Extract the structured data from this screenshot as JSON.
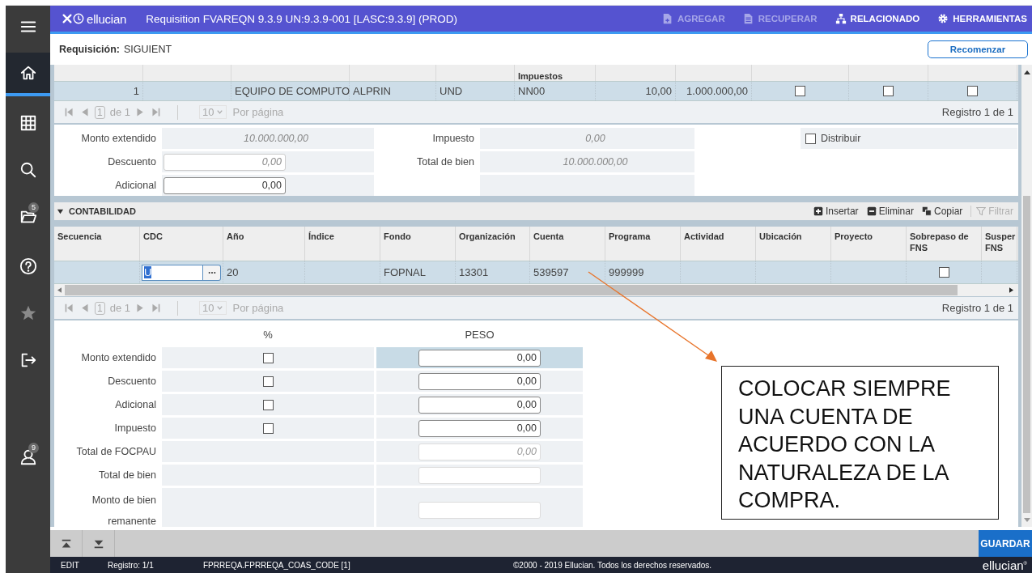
{
  "sidebar": {
    "items": [
      {
        "kind": "menu",
        "selected": false,
        "disabled": false
      },
      {
        "kind": "home",
        "selected": true,
        "disabled": false
      },
      {
        "kind": "grid",
        "selected": false,
        "disabled": false
      },
      {
        "kind": "search",
        "selected": false,
        "disabled": false
      },
      {
        "kind": "folder",
        "selected": false,
        "disabled": false,
        "badge": "5"
      },
      {
        "kind": "help",
        "selected": false,
        "disabled": false
      },
      {
        "kind": "star",
        "selected": false,
        "disabled": true
      },
      {
        "kind": "signout",
        "selected": false,
        "disabled": false
      },
      {
        "kind": "user",
        "selected": false,
        "disabled": false,
        "badge": "9"
      }
    ]
  },
  "header": {
    "logo": "ellucian",
    "title": "Requisition FVAREQN 9.3.9 UN:9.3.9-001 [LASC:9.3.9] (PROD)",
    "actions": [
      {
        "kind": "add",
        "label": "AGREGAR",
        "disabled": true
      },
      {
        "kind": "retrieve",
        "label": "RECUPERAR",
        "disabled": true
      },
      {
        "kind": "related",
        "label": "RELACIONADO",
        "disabled": false
      },
      {
        "kind": "tools",
        "label": "HERRAMIENTAS",
        "disabled": false
      }
    ]
  },
  "key_block": {
    "label": "Requisición:",
    "value": "SIGUIENT",
    "button": "Recomenzar"
  },
  "items_table": {
    "columns": [
      {
        "kind": "number"
      },
      {
        "kind": "text"
      },
      {
        "kind": "text"
      },
      {
        "kind": "text"
      },
      {
        "kind": "text"
      },
      {
        "kind": "text",
        "label": "Impuestos"
      },
      {
        "kind": "number"
      },
      {
        "kind": "number"
      },
      {
        "kind": "check"
      },
      {
        "kind": "check"
      },
      {
        "kind": "check"
      }
    ],
    "rows": [
      {
        "selected": true,
        "cells": [
          {
            "text": "1"
          },
          {},
          {
            "text": "EQUIPO DE COMPUTO"
          },
          {
            "text": "ALPRIN"
          },
          {
            "text": "UND"
          },
          {
            "text": "NN00"
          },
          {
            "text": "10,00"
          },
          {
            "text": "1.000.000,00"
          },
          {
            "checked": false
          },
          {
            "checked": false
          },
          {
            "checked": false
          }
        ]
      }
    ],
    "pager": {
      "page": "1",
      "of": "de 1",
      "per_page": "10",
      "per_page_label": "Por página",
      "record": "Registro 1 de 1"
    }
  },
  "amounts": {
    "left": [
      {
        "kind": "readonly",
        "label": "Monto extendido",
        "value": "10.000.000,00"
      },
      {
        "kind": "input",
        "label": "Descuento",
        "value": "0,00",
        "disabled": true
      },
      {
        "kind": "input",
        "label": "Adicional",
        "value": "0,00",
        "disabled": false
      }
    ],
    "middle": [
      {
        "kind": "readonly",
        "label": "Impuesto",
        "value": "0,00"
      },
      {
        "kind": "readonly",
        "label": "Total de bien",
        "value": "10.000.000,00"
      },
      {
        "kind": "empty"
      }
    ],
    "right": [
      {
        "kind": "checkbox",
        "label": "Distribuir",
        "checked": false
      }
    ]
  },
  "accounting": {
    "title": "CONTABILIDAD",
    "expanded": true,
    "tools": [
      {
        "kind": "insert",
        "label": "Insertar",
        "disabled": false
      },
      {
        "kind": "delete",
        "label": "Eliminar",
        "disabled": false
      },
      {
        "kind": "copy",
        "label": "Copiar",
        "disabled": false
      },
      {
        "kind": "filter",
        "label": "Filtrar",
        "disabled": true
      }
    ],
    "columns": [
      {
        "label": "Secuencia"
      },
      {
        "label": "CDC"
      },
      {
        "label": "Año"
      },
      {
        "label": "Índice"
      },
      {
        "label": "Fondo"
      },
      {
        "label": "Organización"
      },
      {
        "label": "Cuenta"
      },
      {
        "label": "Programa"
      },
      {
        "label": "Actividad"
      },
      {
        "label": "Ubicación"
      },
      {
        "label": "Proyecto"
      },
      {
        "label": "Sobrepaso de FNS"
      },
      {
        "label": "Susper FNS"
      }
    ],
    "rows": [
      {
        "selected": true,
        "cells": [
          {},
          {
            "kind": "lookup",
            "value": "U"
          },
          {
            "text": "20"
          },
          {},
          {
            "text": "FOPNAL"
          },
          {
            "text": "13301"
          },
          {
            "text": "539597"
          },
          {
            "text": "999999"
          },
          {},
          {},
          {},
          {
            "checked": false
          },
          {}
        ]
      }
    ],
    "pager": {
      "page": "1",
      "of": "de 1",
      "per_page": "10",
      "per_page_label": "Por página",
      "record": "Registro 1 de 1"
    }
  },
  "distribution": {
    "percent_header": "%",
    "amount_header": "PESO",
    "rows": [
      {
        "label": "Monto extendido",
        "checked": false,
        "kind": "input",
        "value": "0,00",
        "selected": true
      },
      {
        "label": "Descuento",
        "checked": false,
        "kind": "input",
        "value": "0,00",
        "selected": false
      },
      {
        "label": "Adicional",
        "checked": false,
        "kind": "input",
        "value": "0,00",
        "selected": false
      },
      {
        "label": "Impuesto",
        "checked": false,
        "kind": "input",
        "value": "0,00",
        "selected": false
      },
      {
        "label": "Total de FOCPAU",
        "kind": "readonly",
        "value": "0,00",
        "selected": false
      },
      {
        "label": "Total de bien",
        "kind": "readonly",
        "selected": false
      },
      {
        "label": "Monto de bien remanente",
        "kind": "readonly",
        "selected": false
      }
    ]
  },
  "annotation": {
    "text": "COLOCAR SIEMPRE UNA CUENTA DE ACUERDO CON LA NATURALEZA DE LA COMPRA."
  },
  "toolbar": {
    "nav": [
      {
        "kind": "first"
      },
      {
        "kind": "last"
      }
    ],
    "save": "GUARDAR"
  },
  "status_bar": {
    "mode": "EDIT",
    "record": "Registro: 1/1",
    "field": "FPRREQA.FPRREQA_COAS_CODE [1]",
    "copyright": "©2000 - 2019 Ellucian. Todos los derechos reservados.",
    "logo": "ellucian$^{®}$"
  }
}
